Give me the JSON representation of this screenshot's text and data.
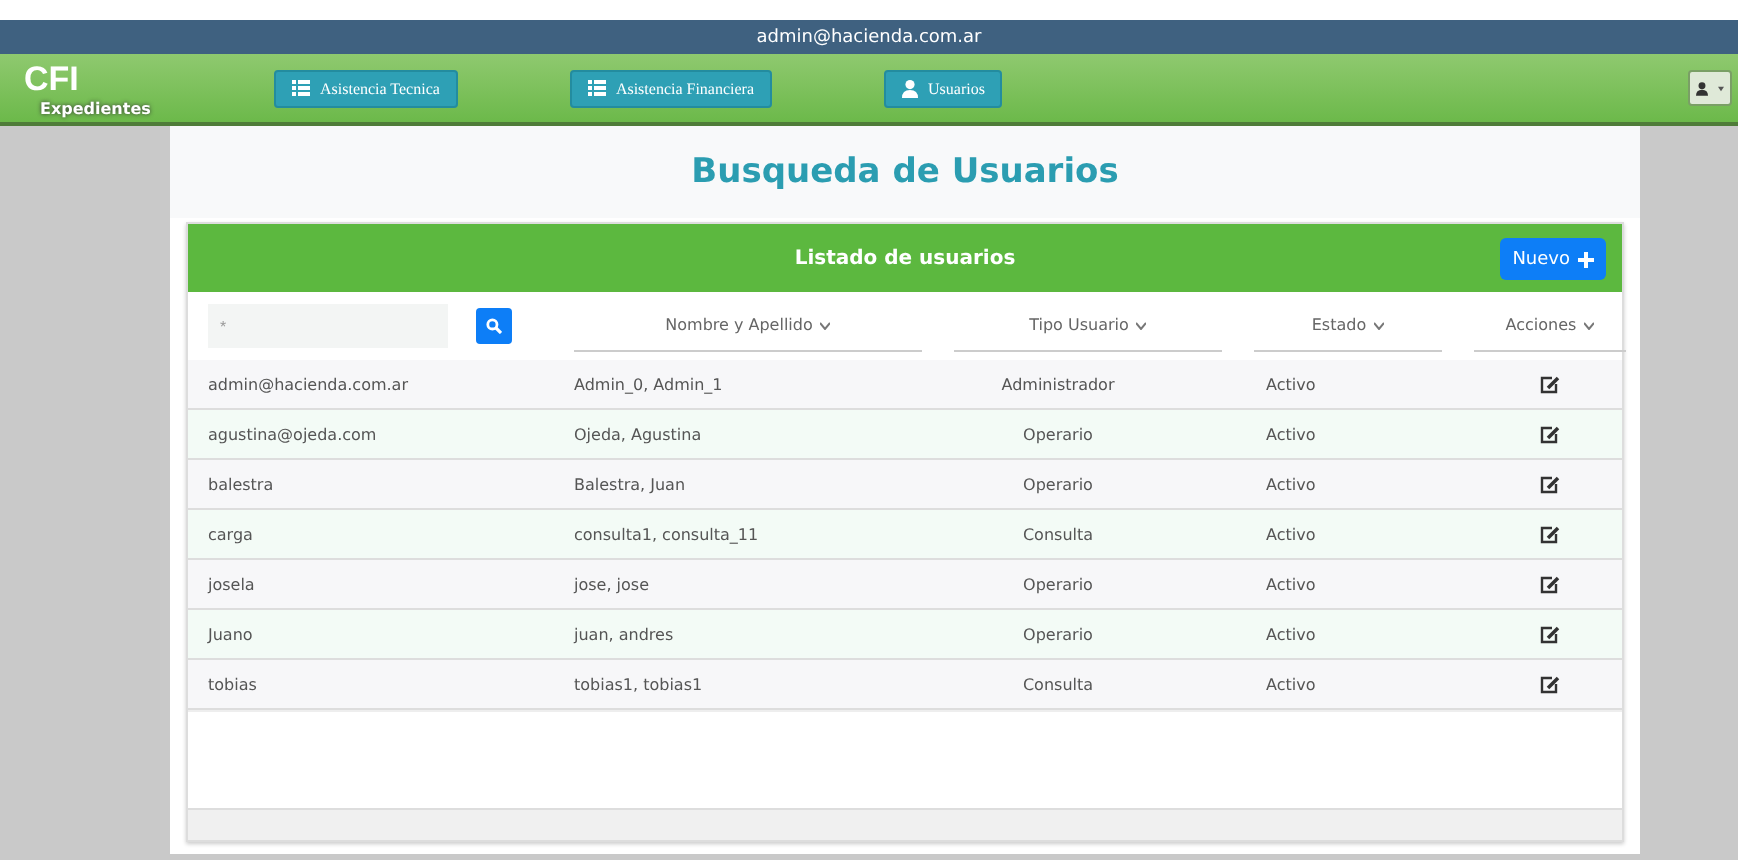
{
  "top_bar": {
    "user_email": "admin@hacienda.com.ar"
  },
  "navbar": {
    "logo_title": "CFI",
    "logo_subtitle": "Expedientes",
    "nav_buttons": [
      {
        "label": "Asistencia Tecnica",
        "kind": "list"
      },
      {
        "label": "Asistencia Financiera",
        "kind": "list"
      },
      {
        "label": "Usuarios",
        "kind": "user"
      }
    ]
  },
  "page_title": "Busqueda de Usuarios",
  "panel": {
    "title": "Listado de usuarios",
    "new_button": "Nuevo",
    "search": {
      "placeholder": "*"
    },
    "columns": [
      "Nombre y Apellido",
      "Tipo Usuario",
      "Estado",
      "Acciones"
    ],
    "rows": [
      {
        "user": "admin@hacienda.com.ar",
        "name": "Admin_0, Admin_1",
        "type": "Administrador",
        "status": "Activo"
      },
      {
        "user": "agustina@ojeda.com",
        "name": "Ojeda, Agustina",
        "type": "Operario",
        "status": "Activo"
      },
      {
        "user": "balestra",
        "name": "Balestra, Juan",
        "type": "Operario",
        "status": "Activo"
      },
      {
        "user": "carga",
        "name": "consulta1, consulta_11",
        "type": "Consulta",
        "status": "Activo"
      },
      {
        "user": "josela",
        "name": "jose, jose",
        "type": "Operario",
        "status": "Activo"
      },
      {
        "user": "Juano",
        "name": "juan, andres",
        "type": "Operario",
        "status": "Activo"
      },
      {
        "user": "tobias",
        "name": "tobias1, tobias1",
        "type": "Consulta",
        "status": "Activo"
      }
    ]
  }
}
